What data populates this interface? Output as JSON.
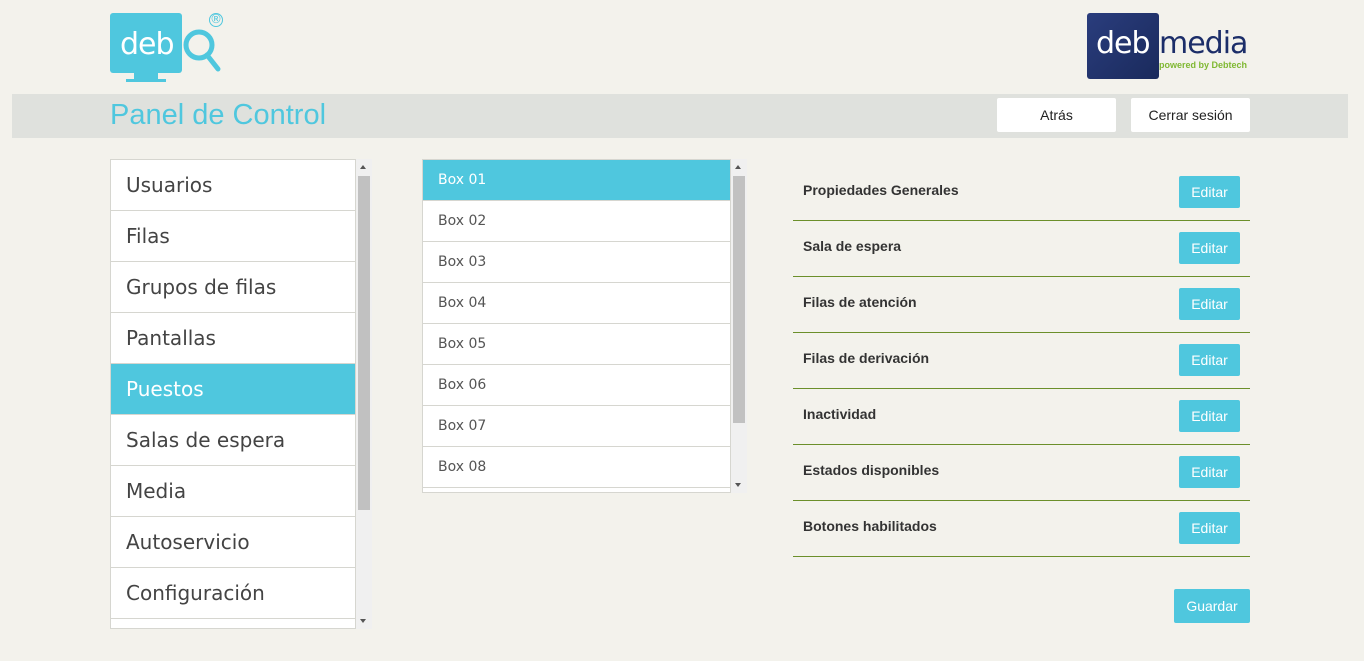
{
  "logos": {
    "left_text": "deb",
    "left_reg": "®",
    "right_deb": "deb",
    "right_media": "media",
    "right_tagline": "powered by Debtech"
  },
  "header": {
    "title": "Panel de Control",
    "back_label": "Atrás",
    "logout_label": "Cerrar sesión"
  },
  "menu": {
    "items": [
      {
        "label": "Usuarios",
        "active": false
      },
      {
        "label": "Filas",
        "active": false
      },
      {
        "label": "Grupos de filas",
        "active": false
      },
      {
        "label": "Pantallas",
        "active": false
      },
      {
        "label": "Puestos",
        "active": true
      },
      {
        "label": "Salas de espera",
        "active": false
      },
      {
        "label": "Media",
        "active": false
      },
      {
        "label": "Autoservicio",
        "active": false
      },
      {
        "label": "Configuración",
        "active": false
      }
    ]
  },
  "boxes": {
    "items": [
      {
        "label": "Box 01",
        "active": true
      },
      {
        "label": "Box 02",
        "active": false
      },
      {
        "label": "Box 03",
        "active": false
      },
      {
        "label": "Box 04",
        "active": false
      },
      {
        "label": "Box 05",
        "active": false
      },
      {
        "label": "Box 06",
        "active": false
      },
      {
        "label": "Box 07",
        "active": false
      },
      {
        "label": "Box 08",
        "active": false
      }
    ]
  },
  "properties": {
    "edit_label": "Editar",
    "items": [
      "Propiedades Generales",
      "Sala de espera",
      "Filas de atención",
      "Filas de derivación",
      "Inactividad",
      "Estados disponibles",
      "Botones habilitados"
    ]
  },
  "save_label": "Guardar",
  "colors": {
    "accent": "#4fc7de",
    "divider": "#6b8f2a",
    "brand_dark": "#1c2e69",
    "brand_green": "#7fb832"
  }
}
